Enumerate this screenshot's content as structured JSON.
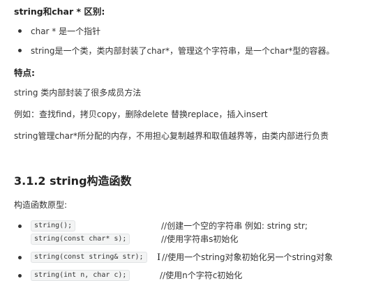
{
  "section1": {
    "title": "string和char * 区别:",
    "bullets": [
      "char * 是一个指针",
      "string是一个类，类内部封装了char*，管理这个字符串，是一个char*型的容器。"
    ]
  },
  "section2": {
    "title": "特点:",
    "paragraphs": [
      "string 类内部封装了很多成员方法",
      "例如：查找find，拷贝copy，删除delete 替换replace，插入insert",
      "string管理char*所分配的内存，不用担心复制越界和取值越界等，由类内部进行负责"
    ]
  },
  "section3": {
    "heading": "3.1.2 string构造函数",
    "intro": "构造函数原型:",
    "items": [
      {
        "code": "string();",
        "comment": "//创建一个空的字符串 例如: string str;",
        "bullet": true
      },
      {
        "code": "string(const char* s);",
        "comment": "//使用字符串s初始化",
        "bullet": false
      },
      {
        "code": "string(const string& str);",
        "comment": "//使用一个string对象初始化另一个string对象",
        "bullet": true
      },
      {
        "code": "string(int n, char c);",
        "comment": "//使用n个字符c初始化",
        "bullet": true
      }
    ]
  }
}
